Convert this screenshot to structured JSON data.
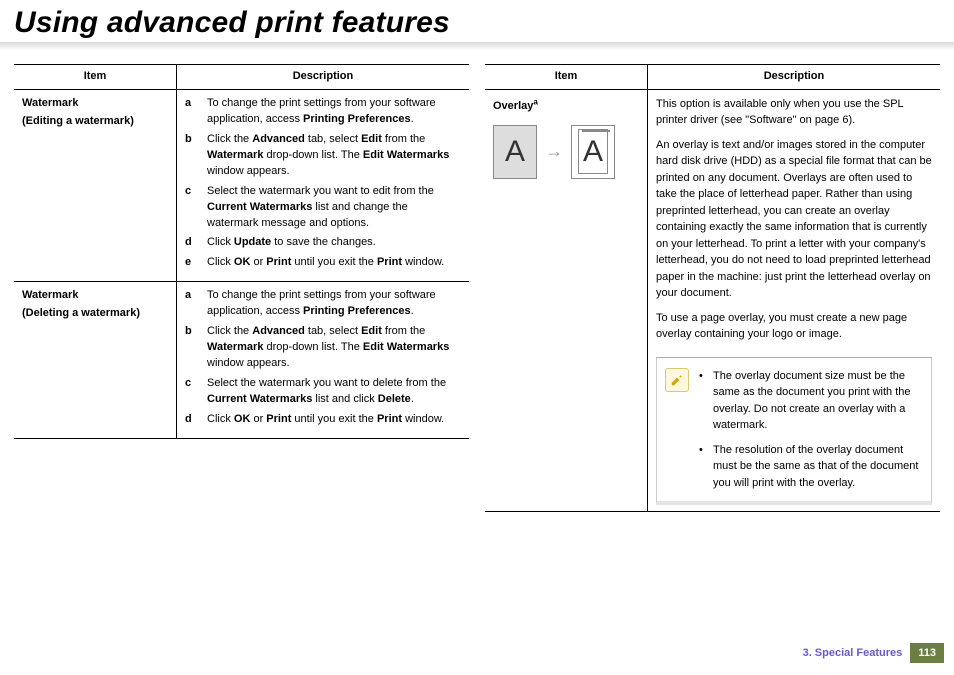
{
  "title": "Using advanced print features",
  "table_headers": {
    "item": "Item",
    "desc": "Description"
  },
  "left_rows": [
    {
      "item_title": "Watermark",
      "item_sub": "(Editing a watermark)",
      "steps": [
        [
          "a",
          "To change the print settings from your software application, access <b>Printing Preferences</b>."
        ],
        [
          "b",
          "Click the <b>Advanced</b> tab, select <b>Edit</b> from the <b>Watermark</b> drop-down list. The <b>Edit Watermarks</b> window appears."
        ],
        [
          "c",
          "Select the watermark you want to edit from the <b>Current Watermarks</b> list and change the watermark message and options."
        ],
        [
          "d",
          "Click <b>Update</b> to save the changes."
        ],
        [
          "e",
          "Click <b>OK</b> or <b>Print</b> until you exit the <b>Print</b> window."
        ]
      ]
    },
    {
      "item_title": "Watermark",
      "item_sub": "(Deleting a watermark)",
      "steps": [
        [
          "a",
          "To change the print settings from your software application, access <b>Printing Preferences</b>."
        ],
        [
          "b",
          "Click the <b>Advanced</b> tab, select <b>Edit</b> from the <b>Watermark</b> drop-down list. The <b>Edit Watermarks</b> window appears."
        ],
        [
          "c",
          "Select the watermark you want to delete from the <b>Current Watermarks</b> list and click <b>Delete</b>."
        ],
        [
          "d",
          "Click <b>OK</b> or <b>Print</b> until you exit the <b>Print</b> window."
        ]
      ]
    }
  ],
  "right_row": {
    "item_title_html": "Overlay<sup>a</sup>",
    "thumb_letter": "A",
    "arrow": "→",
    "paras": [
      "This option is available only when you use the SPL printer driver (see \"Software\" on page 6).",
      "An overlay is text and/or images stored in the computer hard disk drive (HDD) as a special file format that can be printed on any document. Overlays are often used to take the place of letterhead paper. Rather than using preprinted letterhead, you can create an overlay containing exactly the same information that is currently on your letterhead. To print a letter with your company's letterhead, you do not need to load preprinted letterhead paper in the machine: just print the letterhead overlay on your document.",
      "To use a page overlay, you must create a new page overlay containing your logo or image."
    ],
    "notes": [
      "The overlay document size must be the same as the document you print with the overlay. Do not create an overlay with a watermark.",
      "The resolution of the overlay document must be the same as that of the document you will print with the overlay."
    ]
  },
  "footer": {
    "chapter": "3.  Special Features",
    "page": "113"
  }
}
